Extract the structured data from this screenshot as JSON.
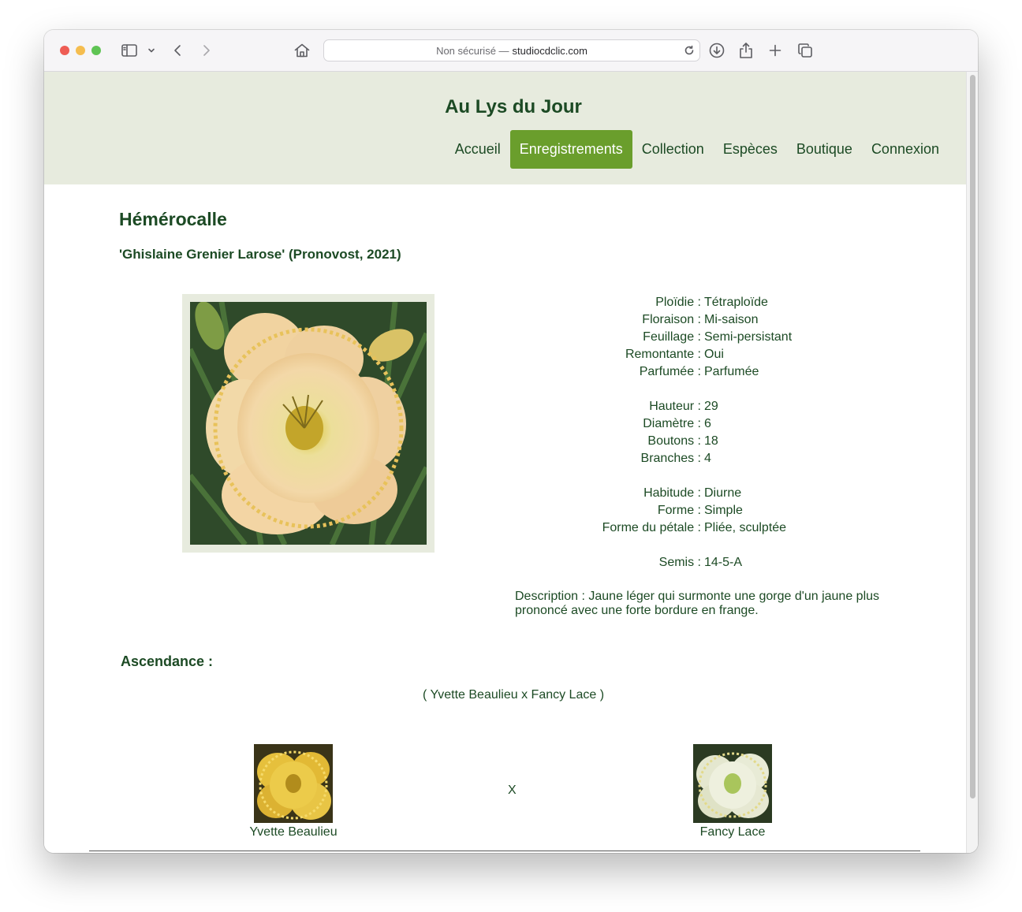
{
  "browser": {
    "url_security": "Non sécurisé —",
    "url_domain": "studiocdclic.com"
  },
  "site": {
    "title": "Au Lys du Jour",
    "nav": [
      {
        "label": "Accueil",
        "active": false
      },
      {
        "label": "Enregistrements",
        "active": true
      },
      {
        "label": "Collection",
        "active": false
      },
      {
        "label": "Espèces",
        "active": false
      },
      {
        "label": "Boutique",
        "active": false
      },
      {
        "label": "Connexion",
        "active": false
      }
    ]
  },
  "plant": {
    "genus": "Hémérocalle",
    "cultivar": "'Ghislaine Grenier Larose' (Pronovost, 2021)",
    "specs": [
      {
        "key": "Ploïdie :",
        "value": "Tétraploïde"
      },
      {
        "key": "Floraison :",
        "value": "Mi-saison"
      },
      {
        "key": "Feuillage :",
        "value": "Semi-persistant"
      },
      {
        "key": "Remontante :",
        "value": "Oui"
      },
      {
        "key": "Parfumée :",
        "value": "Parfumée"
      },
      {
        "key": "Hauteur :",
        "value": "29"
      },
      {
        "key": "Diamètre :",
        "value": "6"
      },
      {
        "key": "Boutons :",
        "value": "18"
      },
      {
        "key": "Branches :",
        "value": "4"
      },
      {
        "key": "Habitude :",
        "value": "Diurne"
      },
      {
        "key": "Forme :",
        "value": "Simple"
      },
      {
        "key": "Forme du pétale :",
        "value": "Pliée, sculptée"
      },
      {
        "key": "Semis :",
        "value": "14-5-A"
      }
    ],
    "description": "Description : Jaune léger qui surmonte une gorge d'un jaune plus prononcé avec une forte bordure en frange."
  },
  "ancestry": {
    "heading": "Ascendance :",
    "cross": "( Yvette Beaulieu x Fancy Lace )",
    "separator": "X",
    "parents": [
      {
        "name": "Yvette Beaulieu"
      },
      {
        "name": "Fancy Lace"
      }
    ]
  },
  "colors": {
    "header_bg": "#e7ebde",
    "text_green": "#1c4a24",
    "nav_active": "#6a9e2c"
  }
}
